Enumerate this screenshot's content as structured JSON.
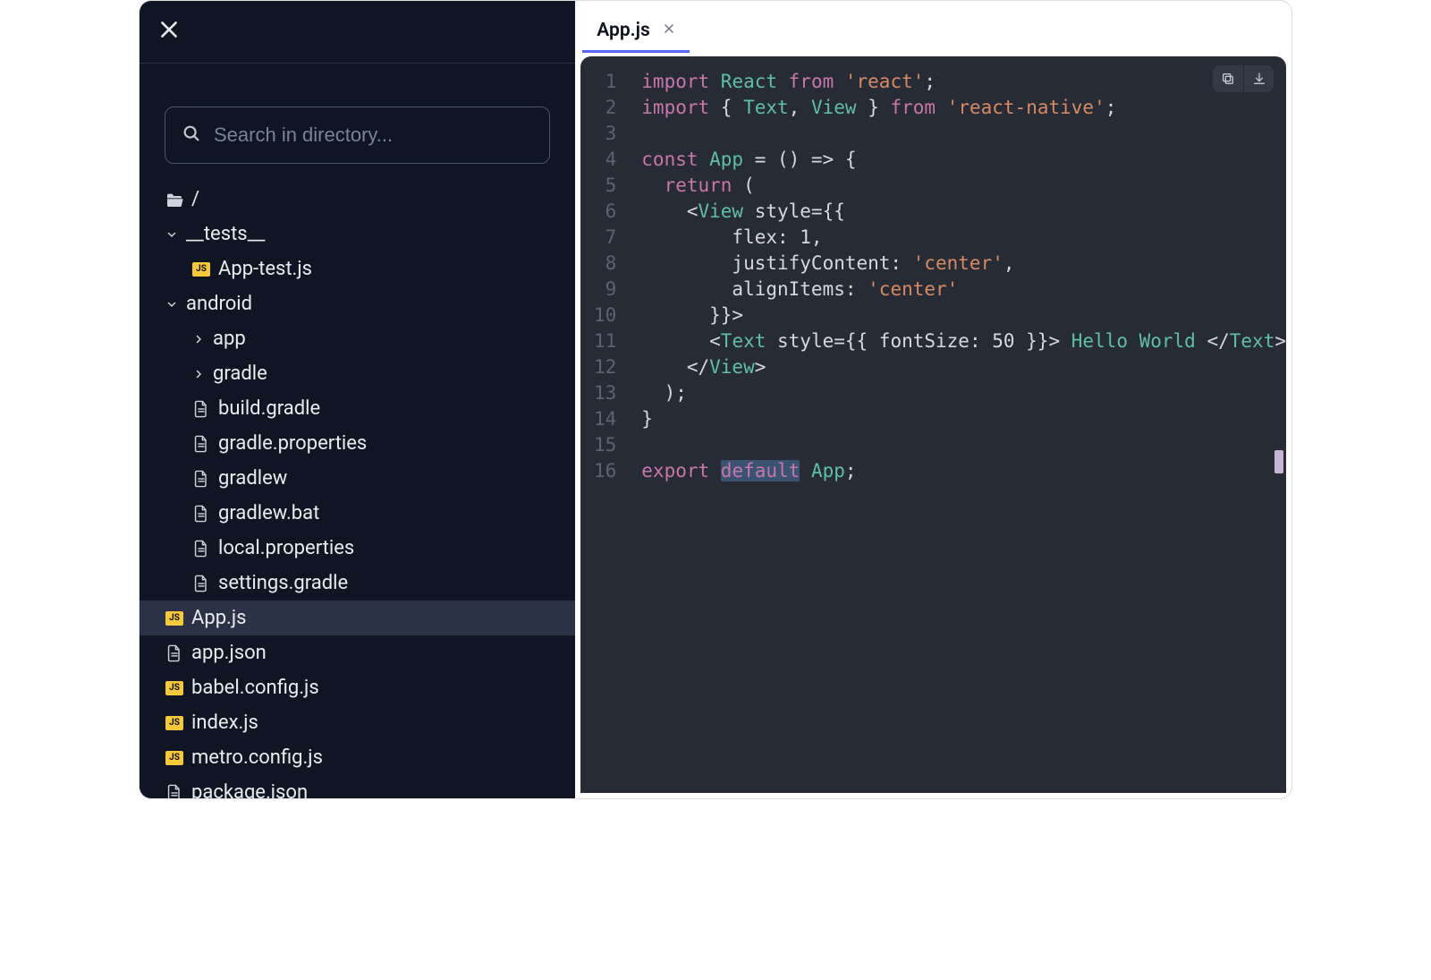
{
  "sidebar": {
    "search_placeholder": "Search in directory...",
    "root_label": "/",
    "tree": [
      {
        "id": "tests",
        "label": "__tests__",
        "kind": "folder",
        "indent": 1,
        "chev": "down"
      },
      {
        "id": "apptest",
        "label": "App-test.js",
        "kind": "js",
        "indent": 2
      },
      {
        "id": "android",
        "label": "android",
        "kind": "folder",
        "indent": 1,
        "chev": "down"
      },
      {
        "id": "app",
        "label": "app",
        "kind": "folder",
        "indent": 2,
        "chev": "right"
      },
      {
        "id": "gradle",
        "label": "gradle",
        "kind": "folder",
        "indent": 2,
        "chev": "right"
      },
      {
        "id": "buildgradle",
        "label": "build.gradle",
        "kind": "file",
        "indent": 2
      },
      {
        "id": "gradleprops",
        "label": "gradle.properties",
        "kind": "file",
        "indent": 2
      },
      {
        "id": "gradlew",
        "label": "gradlew",
        "kind": "file",
        "indent": 2
      },
      {
        "id": "gradlewbat",
        "label": "gradlew.bat",
        "kind": "file",
        "indent": 2
      },
      {
        "id": "localprops",
        "label": "local.properties",
        "kind": "file",
        "indent": 2
      },
      {
        "id": "settingsgradle",
        "label": "settings.gradle",
        "kind": "file",
        "indent": 2
      },
      {
        "id": "appjs",
        "label": "App.js",
        "kind": "js",
        "indent": 1,
        "active": true
      },
      {
        "id": "appjson",
        "label": "app.json",
        "kind": "file",
        "indent": 1
      },
      {
        "id": "babel",
        "label": "babel.config.js",
        "kind": "js",
        "indent": 1
      },
      {
        "id": "indexjs",
        "label": "index.js",
        "kind": "js",
        "indent": 1
      },
      {
        "id": "metro",
        "label": "metro.config.js",
        "kind": "js",
        "indent": 1
      },
      {
        "id": "package",
        "label": "package.json",
        "kind": "file",
        "indent": 1
      }
    ]
  },
  "editor": {
    "tab_label": "App.js",
    "line_count": 16,
    "code_tokens": [
      [
        [
          "import ",
          "k-imp"
        ],
        [
          "React ",
          "k-type"
        ],
        [
          "from ",
          "k-imp"
        ],
        [
          "'react'",
          "str"
        ],
        [
          ";",
          ""
        ]
      ],
      [
        [
          "import ",
          "k-imp"
        ],
        [
          "{ ",
          ""
        ],
        [
          "Text",
          "k-type"
        ],
        [
          ", ",
          ""
        ],
        [
          "View",
          "k-type"
        ],
        [
          " } ",
          ""
        ],
        [
          "from ",
          "k-imp"
        ],
        [
          "'react-native'",
          "str"
        ],
        [
          ";",
          ""
        ]
      ],
      [
        [
          "",
          ""
        ]
      ],
      [
        [
          "const ",
          "k-imp"
        ],
        [
          "App ",
          "k-type"
        ],
        [
          "= () => {",
          ""
        ]
      ],
      [
        [
          "  ",
          ""
        ],
        [
          "return ",
          "k-imp"
        ],
        [
          "(",
          ""
        ]
      ],
      [
        [
          "    <",
          ""
        ],
        [
          "View",
          "k-type"
        ],
        [
          " style={{",
          ""
        ]
      ],
      [
        [
          "        flex: 1,",
          ""
        ]
      ],
      [
        [
          "        justifyContent: ",
          ""
        ],
        [
          "'center'",
          "attr"
        ],
        [
          ",",
          ""
        ]
      ],
      [
        [
          "        alignItems: ",
          ""
        ],
        [
          "'center'",
          "attr"
        ]
      ],
      [
        [
          "      }}>",
          ""
        ]
      ],
      [
        [
          "      <",
          ""
        ],
        [
          "Text",
          "k-type"
        ],
        [
          " style={{ fontSize: 50 }}> ",
          ""
        ],
        [
          "Hello World",
          "k-type"
        ],
        [
          " </",
          ""
        ],
        [
          "Text",
          "k-type"
        ],
        [
          ">",
          ""
        ]
      ],
      [
        [
          "    </",
          ""
        ],
        [
          "View",
          "k-type"
        ],
        [
          ">",
          ""
        ]
      ],
      [
        [
          "  );",
          ""
        ]
      ],
      [
        [
          "}",
          ""
        ]
      ],
      [
        [
          "",
          ""
        ]
      ],
      [
        [
          "export ",
          "k-imp"
        ],
        [
          "default",
          "k-imp sel"
        ],
        [
          " ",
          ""
        ],
        [
          "App",
          "k-type"
        ],
        [
          ";",
          ""
        ]
      ]
    ]
  }
}
